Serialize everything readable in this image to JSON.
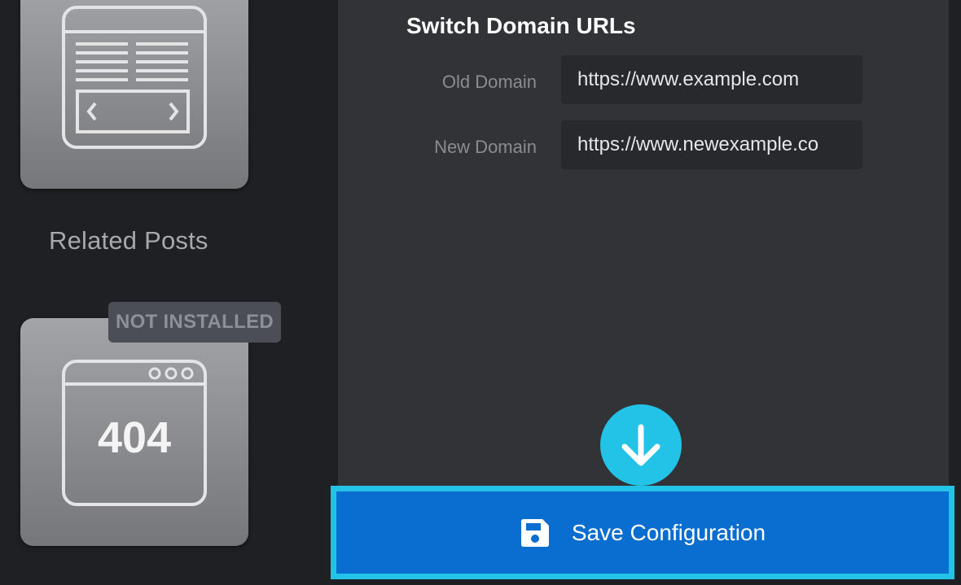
{
  "sidebar": {
    "modules": [
      {
        "name": "slider",
        "icon": "slider-module-icon"
      },
      {
        "name": "404",
        "icon": "404-page-module-icon",
        "icon_text": "404",
        "badge": "NOT INSTALLED"
      }
    ],
    "related_posts_label": "Related Posts"
  },
  "panel": {
    "title": "Switch Domain URLs",
    "fields": [
      {
        "label": "Old Domain",
        "value": "https://www.example.com"
      },
      {
        "label": "New Domain",
        "value": "https://www.newexample.co"
      }
    ]
  },
  "save_button": {
    "label": "Save Configuration",
    "icon": "floppy-disk-icon"
  },
  "hint": {
    "icon": "arrow-down-icon"
  },
  "colors": {
    "background": "#1f2023",
    "panel": "#323337",
    "input": "#28292c",
    "accent_blue": "#0a6ed1",
    "accent_cyan": "#22c3e6",
    "badge": "#4b4e56"
  }
}
